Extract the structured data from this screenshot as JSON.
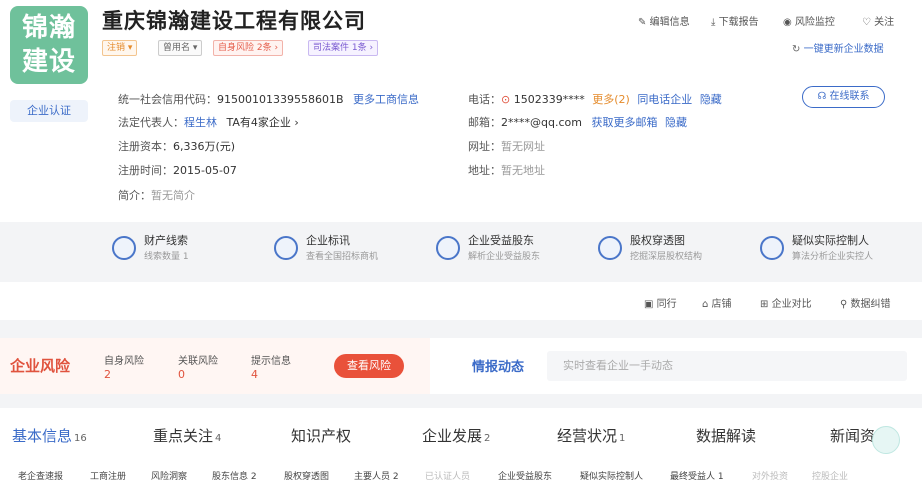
{
  "company": {
    "logo_text_line1": "锦瀚",
    "logo_text_line2": "建设",
    "name": "重庆锦瀚建设工程有限公司",
    "certification": "企业认证"
  },
  "tags": [
    {
      "label": "注销 ▾"
    },
    {
      "label": "曾用名 ▾"
    },
    {
      "label": "自身风险 2条 ›"
    },
    {
      "label": "司法案件 1条 ›"
    }
  ],
  "top_actions": [
    {
      "icon": "edit-icon",
      "label": "编辑信息"
    },
    {
      "icon": "download-icon",
      "label": "下载报告"
    },
    {
      "icon": "eye-icon",
      "label": "风险监控"
    },
    {
      "icon": "heart-icon",
      "label": "关注"
    }
  ],
  "refresh": {
    "label": "一键更新企业数据"
  },
  "info": {
    "credit_code_label": "统一社会信用代码：",
    "credit_code": "91500101339558601B",
    "more_business": "更多工商信息",
    "legal_rep_label": "法定代表人：",
    "legal_rep": "程生林",
    "legal_rep_extra": "TA有4家企业 ›",
    "capital_label": "注册资本：",
    "capital": "6,336万(元)",
    "reg_time_label": "注册时间：",
    "reg_time": "2015-05-07",
    "intro_label": "简介：",
    "intro": "暂无简介",
    "phone_label": "电话：",
    "phone": "1502339****",
    "phone_more": "更多(2)",
    "phone_same": "同电话企业",
    "phone_hide": "隐藏",
    "email_label": "邮箱：",
    "email": "2****@qq.com",
    "email_more": "获取更多邮箱",
    "email_hide": "隐藏",
    "website_label": "网址：",
    "website": "暂无网址",
    "address_label": "地址：",
    "address": "暂无地址",
    "online_contact": "在线联系"
  },
  "features": [
    {
      "title": "财产线索",
      "sub": "线索数量 1",
      "icon": "property-clue-icon"
    },
    {
      "title": "企业标讯",
      "sub": "查看全国招标商机",
      "icon": "bid-info-icon"
    },
    {
      "title": "企业受益股东",
      "sub": "解析企业受益股东",
      "icon": "beneficiary-icon"
    },
    {
      "title": "股权穿透图",
      "sub": "挖掘深层股权结构",
      "icon": "equity-chart-icon"
    },
    {
      "title": "疑似实际控制人",
      "sub": "算法分析企业实控人",
      "icon": "controller-icon"
    }
  ],
  "tools": [
    {
      "label": "同行",
      "icon": "peer-icon"
    },
    {
      "label": "店铺",
      "icon": "shop-icon"
    },
    {
      "label": "企业对比",
      "icon": "compare-icon"
    },
    {
      "label": "数据纠错",
      "icon": "error-report-icon"
    }
  ],
  "risk": {
    "title": "企业风险",
    "items": [
      {
        "label": "自身风险",
        "value": "2"
      },
      {
        "label": "关联风险",
        "value": "0"
      },
      {
        "label": "提示信息",
        "value": "4"
      }
    ],
    "button": "查看风险"
  },
  "intel": {
    "title": "情报动态",
    "placeholder": "实时查看企业一手动态"
  },
  "tabs": [
    {
      "label": "基本信息",
      "count": "16"
    },
    {
      "label": "重点关注",
      "count": "4"
    },
    {
      "label": "知识产权",
      "count": ""
    },
    {
      "label": "企业发展",
      "count": "2"
    },
    {
      "label": "经营状况",
      "count": "1"
    },
    {
      "label": "数据解读",
      "count": ""
    },
    {
      "label": "新闻资",
      "count": ""
    }
  ],
  "subtabs": [
    "老企查速报",
    "工商注册",
    "风险洞察",
    "股东信息 2",
    "股权穿透图",
    "主要人员 2",
    "已认证人员",
    "企业受益股东",
    "疑似实际控制人",
    "最终受益人 1",
    "对外投资",
    "控股企业"
  ]
}
